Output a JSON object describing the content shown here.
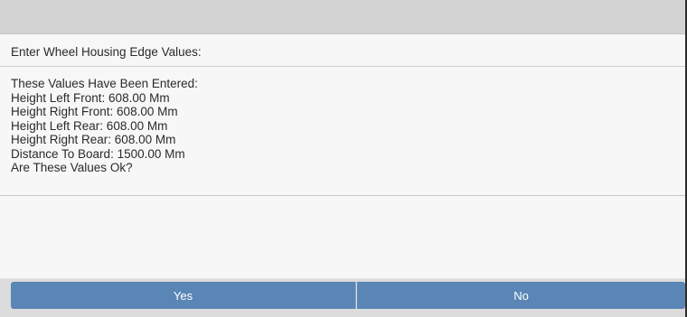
{
  "dialog": {
    "title": "",
    "prompt": "Enter Wheel Housing Edge Values:",
    "message_lines": [
      "These Values Have Been Entered:",
      "Height Left Front: 608.00 Mm",
      "Height Right Front: 608.00 Mm",
      "Height Left Rear: 608.00 Mm",
      "Height Right Rear: 608.00 Mm",
      "Distance To Board: 1500.00 Mm",
      "Are These Values Ok?"
    ]
  },
  "buttons": {
    "yes_label": "Yes",
    "no_label": "No"
  },
  "colors": {
    "button_blue": "#5a86b6",
    "title_bar": "#d3d3d3",
    "panel": "#f7f7f7"
  }
}
